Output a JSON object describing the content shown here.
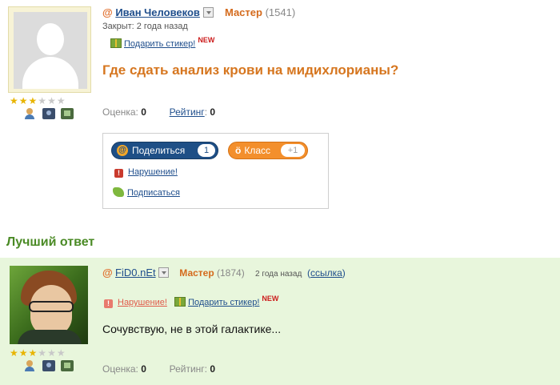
{
  "question": {
    "author": "Иван Человеков",
    "level": "Мастер",
    "points": "(1541)",
    "closed": "Закрыт: 2 года назад",
    "gift_label": "Подарить стикер!",
    "new_badge": "NEW",
    "title": "Где сдать анализ крови на мидихлорианы?",
    "rating_stars": 3,
    "max_stars": 6,
    "score_label": "Оценка:",
    "score_value": "0",
    "rating_label": "Рейтинг",
    "rating_sep": ":",
    "rating_value": "0",
    "share": {
      "share_label": "Поделиться",
      "share_count": "1",
      "class_label": "Класс",
      "class_count": "+1",
      "violation_label": "Нарушение!",
      "subscribe_label": "Подписаться"
    }
  },
  "best_answer": {
    "heading": "Лучший ответ",
    "author": "FiD0.nEt",
    "level": "Мастер",
    "points": "(1874)",
    "time": "2 года назад",
    "link_open": "(",
    "link_label": "ссылка",
    "link_close": ")",
    "violation_label": "Нарушение!",
    "gift_label": "Подарить стикер!",
    "new_badge": "NEW",
    "text": "Сочувствую, не в этой галактике...",
    "rating_stars": 3,
    "max_stars": 6,
    "score_label": "Оценка:",
    "score_value": "0",
    "rating_label": "Рейтинг:",
    "rating_value": "0"
  },
  "icons": {
    "mail_at": "@",
    "star": "★",
    "warning": "!"
  },
  "colors": {
    "title_orange": "#d6761f",
    "best_green": "#4a8a25",
    "answer_bg": "#e8f6dc",
    "link_blue": "#1f4e8c",
    "share_blue": "#1e4f86",
    "class_orange": "#f38f2c"
  }
}
